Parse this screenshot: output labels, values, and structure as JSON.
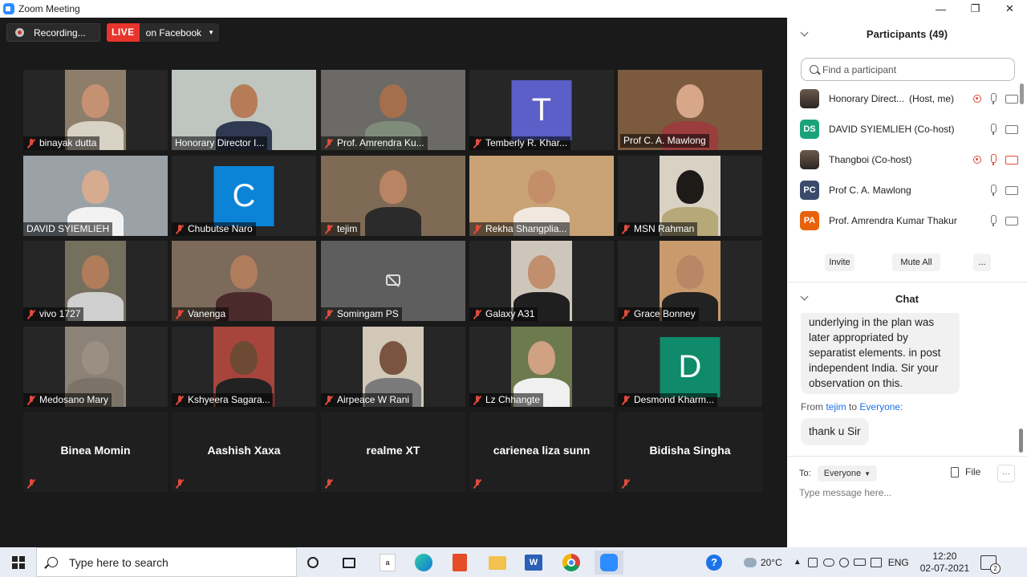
{
  "window": {
    "title": "Zoom Meeting",
    "minimize": "—",
    "restore": "❐",
    "close": "✕"
  },
  "topbar": {
    "recording_label": "Recording...",
    "live_badge": "LIVE",
    "live_target": "on Facebook",
    "live_caret": "▼"
  },
  "tiles": [
    {
      "name": "binayak dutta",
      "kind": "video"
    },
    {
      "name": "Honorary Director I...",
      "kind": "video"
    },
    {
      "name": "Prof.  Amrendra Ku...",
      "kind": "video"
    },
    {
      "name": "Temberly R. Khar...",
      "kind": "avatar",
      "initial": "T",
      "color": "#5b5fc7"
    },
    {
      "name": "Prof C. A. Mawlong",
      "kind": "video",
      "speaker": true
    },
    {
      "name": "DAVID SYIEMLIEH",
      "kind": "video"
    },
    {
      "name": "Chubutse Naro",
      "kind": "avatar",
      "initial": "C",
      "color": "#0b84d8"
    },
    {
      "name": "tejim",
      "kind": "video"
    },
    {
      "name": "Rekha Shangplia...",
      "kind": "video"
    },
    {
      "name": "MSN Rahman",
      "kind": "video"
    },
    {
      "name": "vivo 1727",
      "kind": "video"
    },
    {
      "name": "Vanenga",
      "kind": "video"
    },
    {
      "name": "Somingam PS",
      "kind": "camoff"
    },
    {
      "name": "Galaxy A31",
      "kind": "video"
    },
    {
      "name": "Grace Bonney",
      "kind": "video"
    },
    {
      "name": "Medosano Mary",
      "kind": "video"
    },
    {
      "name": "Kshyeera Sagara...",
      "kind": "video"
    },
    {
      "name": "Airpeace W Rani",
      "kind": "video"
    },
    {
      "name": "Lz Chhangte",
      "kind": "video"
    },
    {
      "name": "Desmond Kharm...",
      "kind": "avatar",
      "initial": "D",
      "color": "#0f8a6a"
    },
    {
      "name": "Binea Momin",
      "kind": "nameonly"
    },
    {
      "name": "Aashish Xaxa",
      "kind": "nameonly"
    },
    {
      "name": "realme XT",
      "kind": "nameonly"
    },
    {
      "name": "carienea liza sunn",
      "kind": "nameonly"
    },
    {
      "name": "Bidisha Singha",
      "kind": "nameonly"
    }
  ],
  "participants_panel": {
    "title": "Participants (49)",
    "search_placeholder": "Find a participant",
    "list": [
      {
        "name": "Honorary Direct...",
        "role": "(Host, me)",
        "avatar": "photo",
        "recording": true,
        "mic_off": false,
        "cam_off": false
      },
      {
        "name": "DAVID SYIEMLIEH (Co-host)",
        "role": "",
        "avatar": "DS",
        "avatar_color": "#1aa37a",
        "recording": false,
        "mic_off": false,
        "cam_off": false
      },
      {
        "name": "Thangboi (Co-host)",
        "role": "",
        "avatar": "photo",
        "recording": true,
        "mic_off": true,
        "cam_off": true
      },
      {
        "name": "Prof C. A. Mawlong",
        "role": "",
        "avatar": "PC",
        "avatar_color": "#3b4a6b",
        "recording": false,
        "mic_off": false,
        "cam_off": false
      },
      {
        "name": "Prof.  Amrendra Kumar Thakur",
        "role": "",
        "avatar": "PA",
        "avatar_color": "#e8620c",
        "recording": false,
        "mic_off": false,
        "cam_off": false
      }
    ],
    "invite": "Invite",
    "mute_all": "Mute All",
    "more": "..."
  },
  "chat": {
    "title": "Chat",
    "bubble_lines": [
      "underlying in the plan was",
      "later appropriated by",
      "separatist elements. in post",
      "independent India. Sir your",
      "observation on this."
    ],
    "from_prefix": "From",
    "from_sender": "tejim",
    "from_mid": "to",
    "from_recipient": "Everyone:",
    "last_message": "thank u Sir",
    "to_label": "To:",
    "to_value": "Everyone",
    "file_label": "File",
    "more": "···",
    "input_placeholder": "Type message here..."
  },
  "taskbar": {
    "search_placeholder": "Type here to search",
    "weather": "20°C",
    "lang": "ENG",
    "time": "12:20",
    "date": "02-07-2021",
    "notifications": "2"
  }
}
